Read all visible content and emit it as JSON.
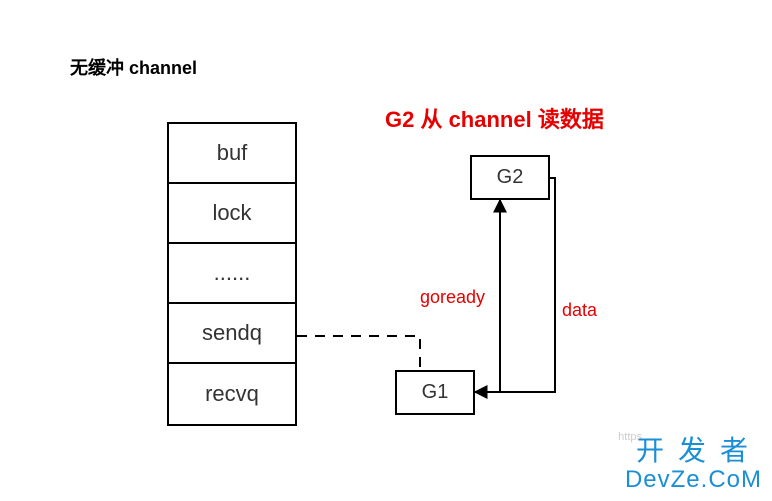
{
  "title": "无缓冲 channel",
  "subtitle": "G2 从 channel 读数据",
  "struct_cells": {
    "c0": "buf",
    "c1": "lock",
    "c2": "......",
    "c3": "sendq",
    "c4": "recvq"
  },
  "g1_label": "G1",
  "g2_label": "G2",
  "edge_goready": "goready",
  "edge_data": "data",
  "watermark_cn": "开发者",
  "watermark_en": "DevZe.CoM",
  "watermark_https": "https"
}
